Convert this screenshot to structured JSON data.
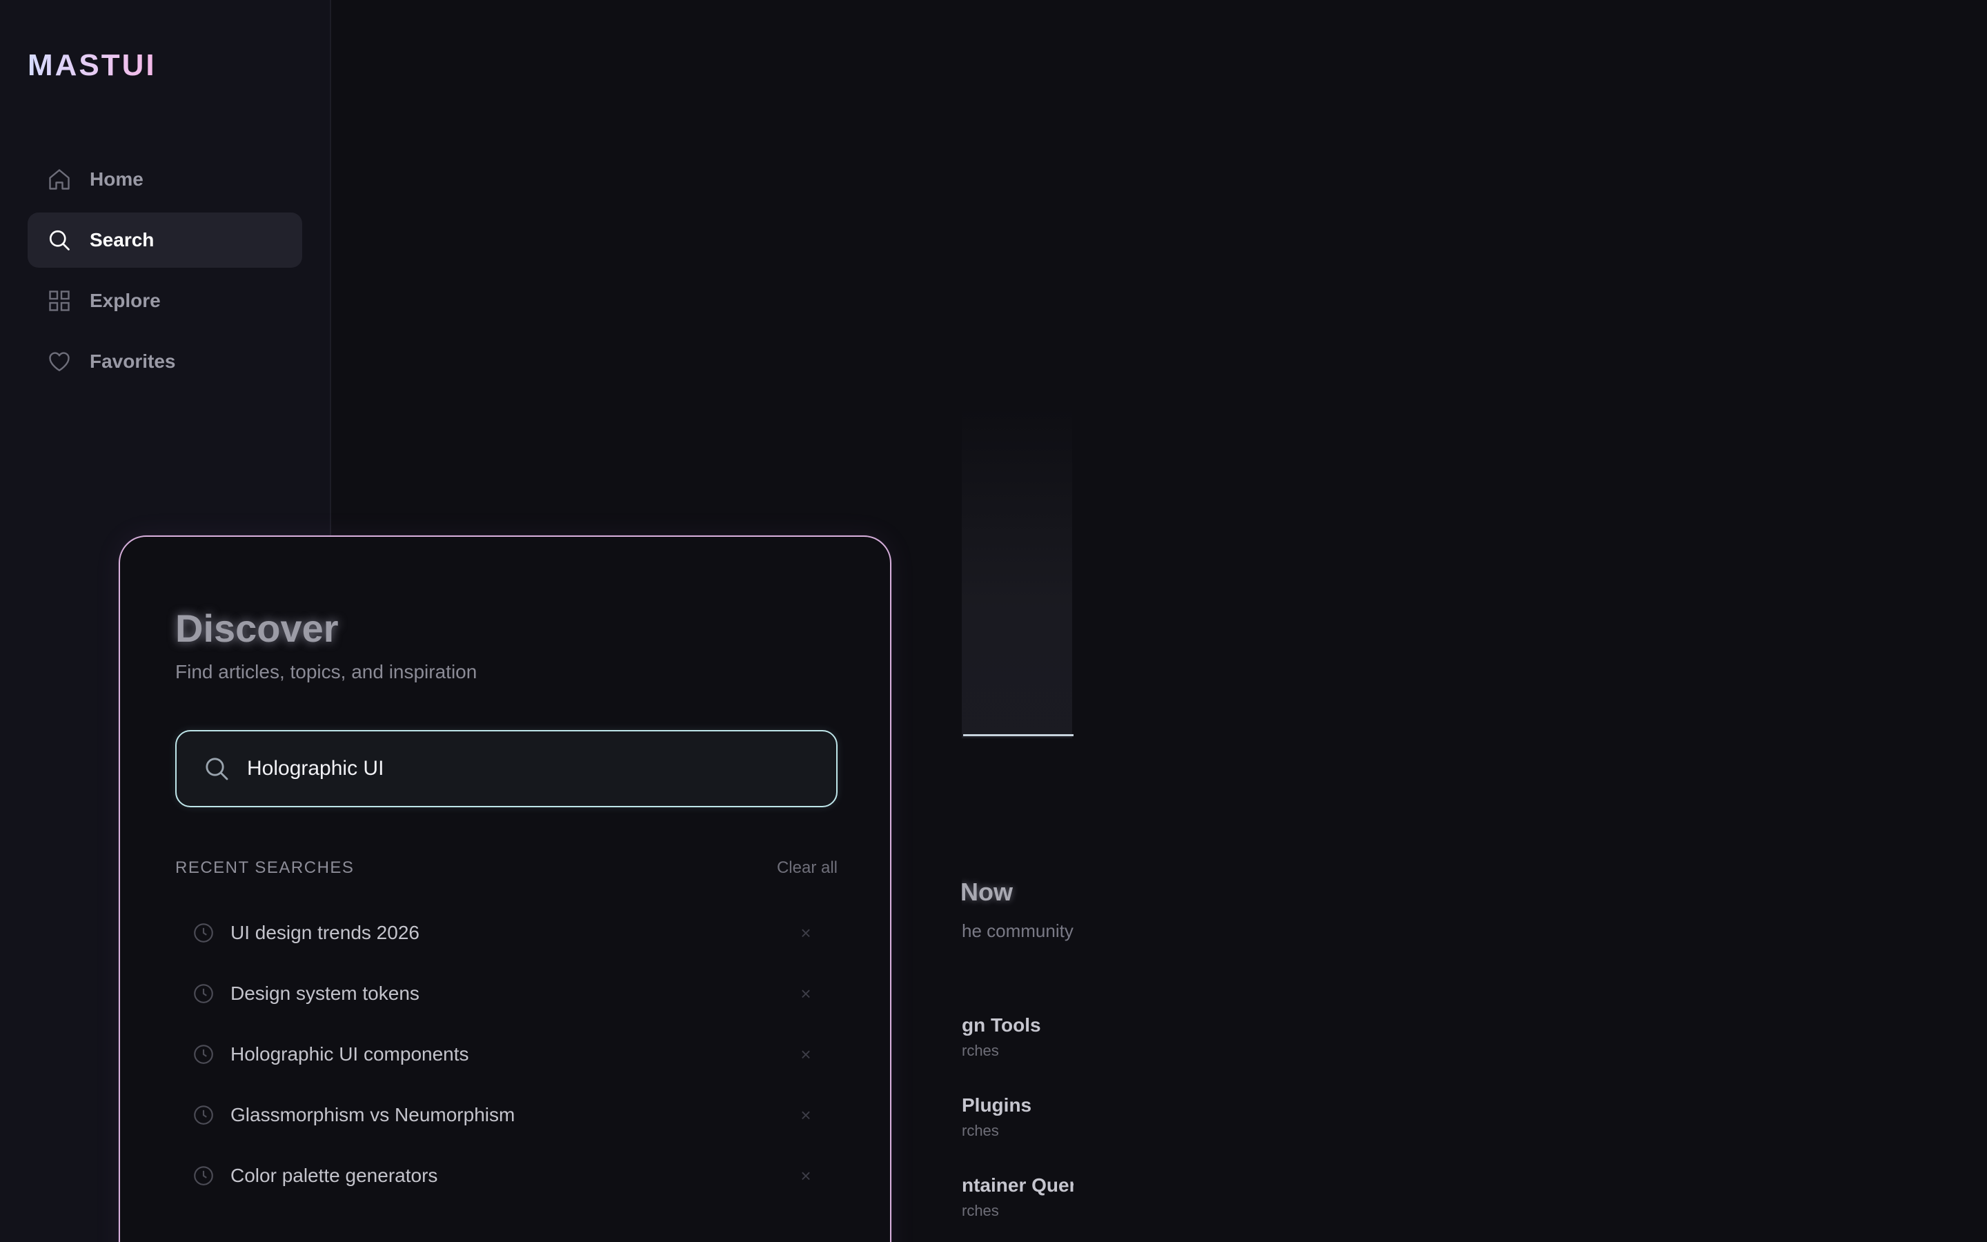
{
  "app": {
    "logo": "MASTUI"
  },
  "sidebar": {
    "items": [
      {
        "label": "Home",
        "icon": "home-icon",
        "active": false
      },
      {
        "label": "Search",
        "icon": "search-icon",
        "active": true
      },
      {
        "label": "Explore",
        "icon": "grid-icon",
        "active": false
      },
      {
        "label": "Favorites",
        "icon": "heart-icon",
        "active": false
      }
    ]
  },
  "background": {
    "trending_title": "Now",
    "trending_sub": "he community",
    "items": [
      {
        "title": "gn Tools",
        "sub": "rches"
      },
      {
        "title": "Plugins",
        "sub": "rches"
      },
      {
        "title": "ntainer Quer",
        "sub": "rches"
      }
    ]
  },
  "discover": {
    "title": "Discover",
    "subtitle": "Find articles, topics, and inspiration",
    "search": {
      "value": "Holographic UI",
      "placeholder": ""
    },
    "recent_label": "RECENT SEARCHES",
    "clear_label": "Clear all",
    "recent": [
      {
        "text": "UI design trends 2026",
        "remove": "×"
      },
      {
        "text": "Design system tokens",
        "remove": "×"
      },
      {
        "text": "Holographic UI components",
        "remove": "×"
      },
      {
        "text": "Glassmorphism vs Neumorphism",
        "remove": "×"
      },
      {
        "text": "Color palette generators",
        "remove": "×"
      }
    ]
  },
  "colors": {
    "background": "#0e0e13",
    "sidebar": "#12121a",
    "panel_border": "#d8b0dc",
    "search_border": "#bfe6ea"
  }
}
